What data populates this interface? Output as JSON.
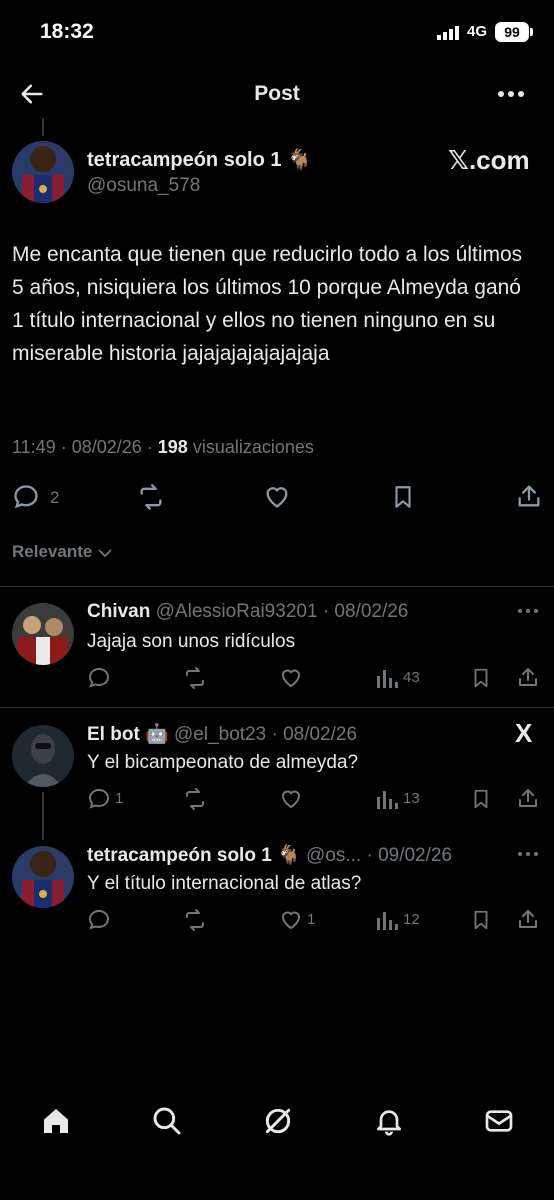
{
  "status_bar": {
    "time": "18:32",
    "network": "4G",
    "battery": "99"
  },
  "header": {
    "title": "Post"
  },
  "post": {
    "author_name": "tetracampeón solo 1 🐐",
    "handle": "@osuna_578",
    "source": "𝕏.com",
    "text": "Me encanta que tienen que reducirlo todo a los últimos 5 años, nisiquiera los últimos 10  porque Almeyda ganó 1 título internacional y ellos no tienen ninguno en su miserable historia jajajajajajajajaja",
    "time_date": "11:49 · 08/02/26 · ",
    "views_count": "198",
    "views_label": " visualizaciones",
    "reply_count": "2"
  },
  "filter": {
    "label": "Relevante"
  },
  "replies": [
    {
      "name": "Chivan",
      "handle_date": "@AlessioRai93201 · 08/02/26",
      "text": "Jajaja son unos ridículos",
      "replies": "",
      "likes": "",
      "views": "43"
    },
    {
      "name": "El bot 🤖",
      "handle_date": "@el_bot23 · 08/02/26",
      "text": "Y el bicampeonato de almeyda?",
      "replies": "1",
      "likes": "",
      "views": "13",
      "badge": "X"
    },
    {
      "name": "tetracampeón solo 1 🐐",
      "handle_date": "@os... · 09/02/26",
      "text": "Y el título internacional de atlas?",
      "replies": "",
      "likes": "1",
      "views": "12"
    }
  ],
  "colors": {
    "background": "#000000",
    "text": "#e7e9ea",
    "muted": "#71767b",
    "divider": "#2f3336"
  },
  "icons": [
    "back-arrow-icon",
    "more-icon",
    "reply-icon",
    "retweet-icon",
    "like-icon",
    "bookmark-icon",
    "share-icon",
    "views-icon",
    "home-icon",
    "search-icon",
    "grok-icon",
    "bell-icon",
    "mail-icon"
  ]
}
